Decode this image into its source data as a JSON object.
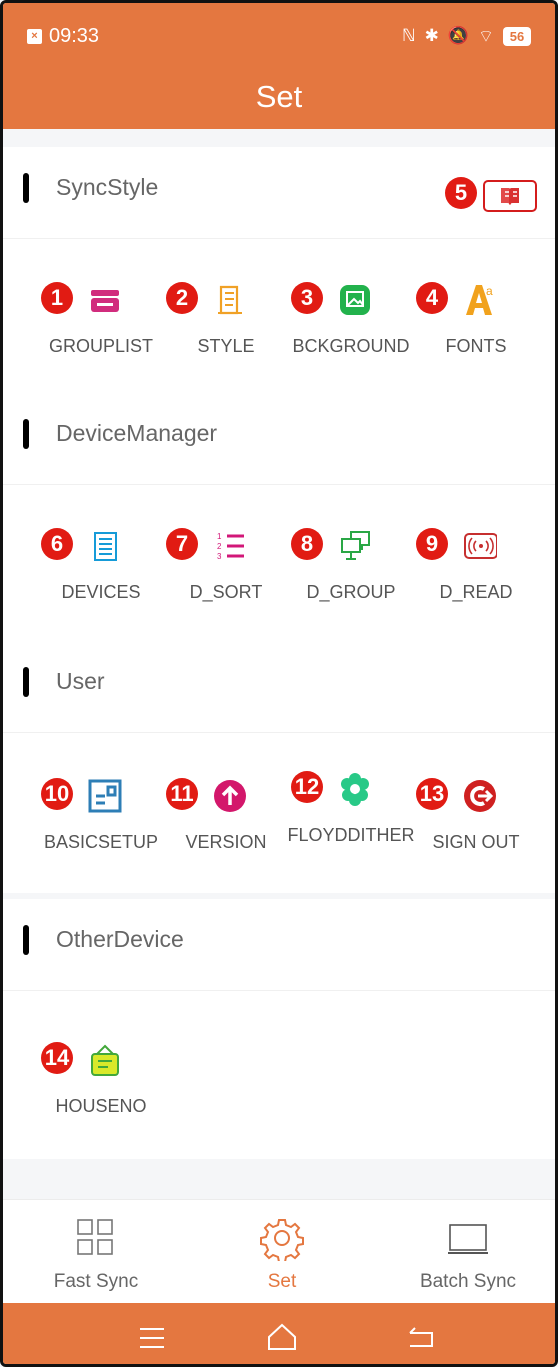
{
  "status_bar": {
    "time": "09:33",
    "battery": "56"
  },
  "header": {
    "title": "Set"
  },
  "sections": [
    {
      "title": "SyncStyle",
      "items": [
        {
          "number": "1",
          "label": "GROUPLIST",
          "icon": "grouplist-icon"
        },
        {
          "number": "2",
          "label": "STYLE",
          "icon": "style-icon"
        },
        {
          "number": "3",
          "label": "BCKGROUND",
          "icon": "background-image-icon"
        },
        {
          "number": "4",
          "label": "FONTS",
          "icon": "fonts-icon"
        }
      ],
      "extra_badge": "5"
    },
    {
      "title": "DeviceManager",
      "items": [
        {
          "number": "6",
          "label": "DEVICES",
          "icon": "devices-icon"
        },
        {
          "number": "7",
          "label": "D_SORT",
          "icon": "numbered-list-icon"
        },
        {
          "number": "8",
          "label": "D_GROUP",
          "icon": "monitor-group-icon"
        },
        {
          "number": "9",
          "label": "D_READ",
          "icon": "nfc-read-icon"
        }
      ]
    },
    {
      "title": "User",
      "items": [
        {
          "number": "10",
          "label": "BASICSETUP",
          "icon": "basic-setup-icon"
        },
        {
          "number": "11",
          "label": "VERSION",
          "icon": "upload-arrow-icon"
        },
        {
          "number": "12",
          "label": "FLOYDDITHER",
          "icon": "dither-flower-icon"
        },
        {
          "number": "13",
          "label": "SIGN OUT",
          "icon": "sign-out-icon"
        }
      ]
    },
    {
      "title": "OtherDevice",
      "items": [
        {
          "number": "14",
          "label": "HOUSENO",
          "icon": "house-number-icon"
        }
      ]
    }
  ],
  "bottom_nav": [
    {
      "label": "Fast Sync",
      "icon": "grid-icon",
      "active": false
    },
    {
      "label": "Set",
      "icon": "gear-icon",
      "active": true
    },
    {
      "label": "Batch Sync",
      "icon": "monitor-icon",
      "active": false
    }
  ],
  "system_nav": {
    "menu": "menu-icon",
    "home": "home-icon",
    "back": "back-icon"
  },
  "colors": {
    "accent": "#e47740",
    "badge": "#e11b13"
  }
}
